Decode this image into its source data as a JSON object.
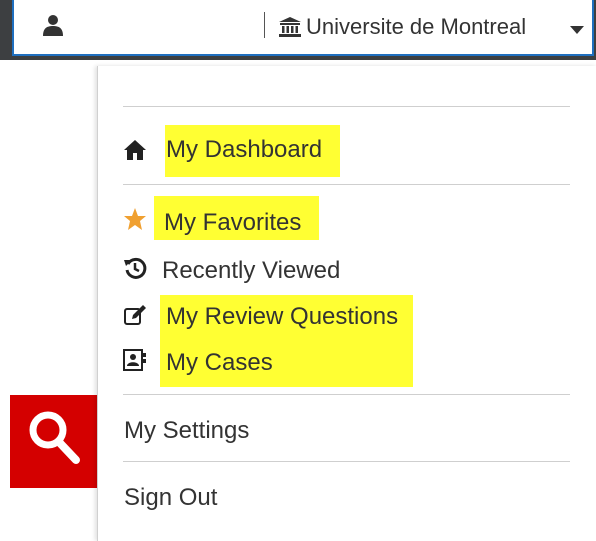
{
  "topbar": {
    "user_icon": "user-icon",
    "institution_icon": "institution-icon",
    "institution": "Universite de Montreal",
    "dropdown_icon": "caret-down-icon"
  },
  "menu": {
    "dashboard": {
      "label": "My Dashboard",
      "icon": "home-icon",
      "highlighted": true
    },
    "favorites": {
      "label": "My Favorites",
      "icon": "star-icon",
      "highlighted": true
    },
    "recently_viewed": {
      "label": "Recently Viewed",
      "icon": "history-icon",
      "highlighted": false
    },
    "review_questions": {
      "label": "My Review Questions",
      "icon": "edit-icon",
      "highlighted": true
    },
    "cases": {
      "label": "My Cases",
      "icon": "id-card-icon",
      "highlighted": true
    },
    "settings": {
      "label": "My Settings"
    },
    "sign_out": {
      "label": "Sign Out"
    }
  },
  "background": {
    "search_icon": "search-icon"
  },
  "colors": {
    "highlight": "#ffff33",
    "star": "#f0a030",
    "search_bg": "#d40000",
    "topbar_border": "#1f6fbf"
  }
}
